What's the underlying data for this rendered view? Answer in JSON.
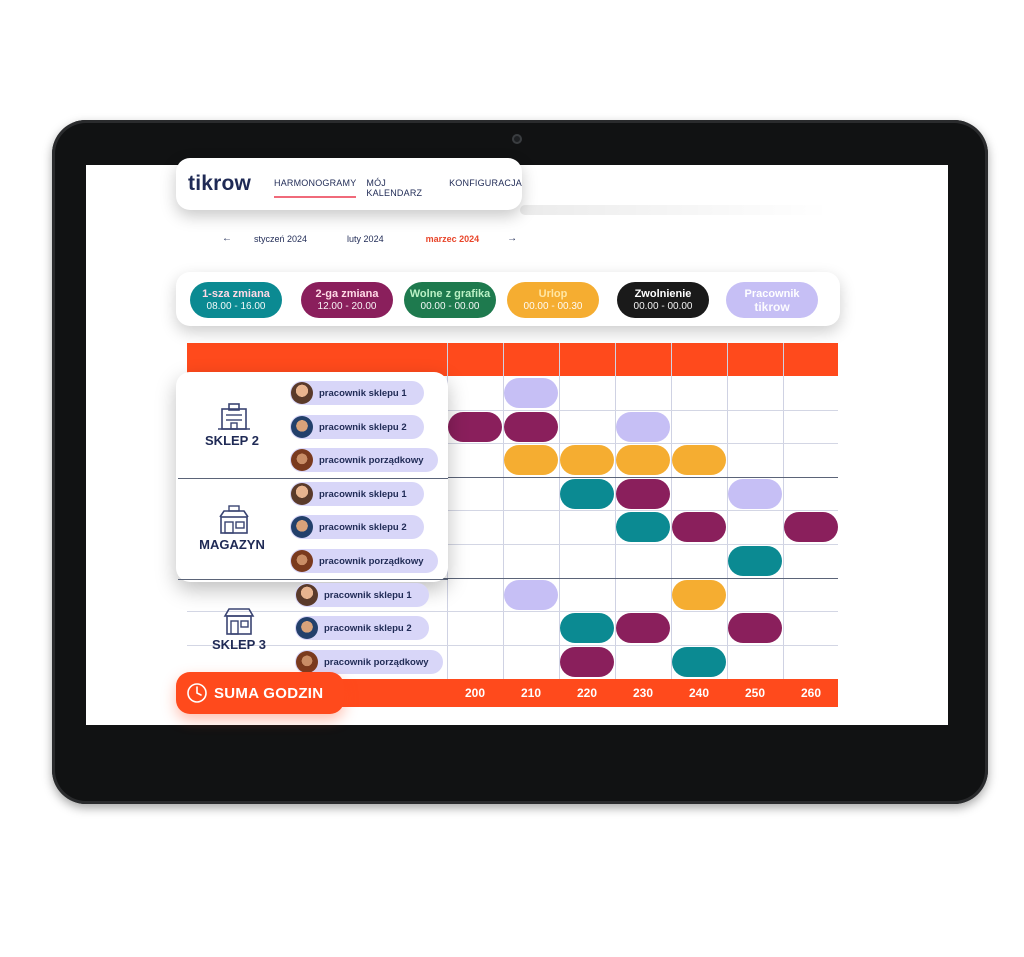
{
  "app": {
    "logo": "tikrow",
    "nav": [
      {
        "label": "HARMONOGRAMY",
        "active": true
      },
      {
        "label": "MÓJ KALENDARZ",
        "active": false
      },
      {
        "label": "KONFIGURACJA",
        "active": false
      }
    ]
  },
  "months": {
    "prev_icon": "arrow-left-icon",
    "next_icon": "arrow-right-icon",
    "items": [
      {
        "label": "styczeń 2024",
        "active": false
      },
      {
        "label": "luty 2024",
        "active": false
      },
      {
        "label": "marzec 2024",
        "active": true
      }
    ]
  },
  "legend": [
    {
      "label": "1-sza zmiana",
      "time": "08.00 - 16.00",
      "color": "#0b8a92",
      "label_color": "#ffd9e6"
    },
    {
      "label": "2-ga zmiana",
      "time": "12.00 - 20.00",
      "color": "#8a1f5c",
      "label_color": "#ffd9e6"
    },
    {
      "label": "Wolne z grafika",
      "time": "00.00 - 00.00",
      "color": "#1e7a4e",
      "label_color": "#b9f0c4"
    },
    {
      "label": "Urlop",
      "time": "00.00 - 00.30",
      "color": "#f5ad31",
      "label_color": "#ffe6a3"
    },
    {
      "label": "Zwolnienie",
      "time": "00.00 - 00.00",
      "color": "#1a1a1a",
      "label_color": "#ffffff"
    },
    {
      "label": "Pracownik",
      "time": "tikrow",
      "color": "#c6bff5",
      "label_color": "#ffffff"
    }
  ],
  "groups": [
    {
      "name": "SKLEP 2",
      "icon": "store-building-icon",
      "employees": [
        "pracownik sklepu 1",
        "pracownik sklepu 2",
        "pracownik porządkowy"
      ]
    },
    {
      "name": "MAGAZYN",
      "icon": "warehouse-icon",
      "employees": [
        "pracownik sklepu 1",
        "pracownik sklepu 2",
        "pracownik porządkowy"
      ]
    },
    {
      "name": "SKLEP 3",
      "icon": "shop-front-icon",
      "employees": [
        "pracownik sklepu 1",
        "pracownik sklepu 2",
        "pracownik porządkowy"
      ]
    }
  ],
  "schedule": [
    [
      null,
      "tikrow",
      null,
      null,
      null,
      null,
      null
    ],
    [
      "2-ga",
      "2-ga",
      null,
      "tikrow",
      null,
      null,
      null
    ],
    [
      null,
      "urlop",
      "urlop",
      "urlop",
      "urlop",
      null,
      null
    ],
    [
      null,
      null,
      "1-sza",
      "2-ga",
      null,
      "tikrow",
      null
    ],
    [
      null,
      null,
      null,
      "1-sza",
      "2-ga",
      null,
      "2-ga"
    ],
    [
      null,
      null,
      null,
      null,
      null,
      "1-sza",
      null
    ],
    [
      null,
      "tikrow",
      null,
      null,
      "urlop",
      null,
      null
    ],
    [
      null,
      null,
      "1-sza",
      "2-ga",
      null,
      "2-ga",
      null
    ],
    [
      null,
      null,
      "2-ga",
      null,
      "1-sza",
      null,
      null
    ]
  ],
  "totals": [
    "200",
    "210",
    "220",
    "230",
    "240",
    "250",
    "260"
  ],
  "summary": {
    "label": "SUMA GODZIN",
    "icon": "clock-icon"
  },
  "colors": {
    "accent": "#ff4a1c",
    "navy": "#1f2a55",
    "employee_pill": "#d8d6f8"
  }
}
